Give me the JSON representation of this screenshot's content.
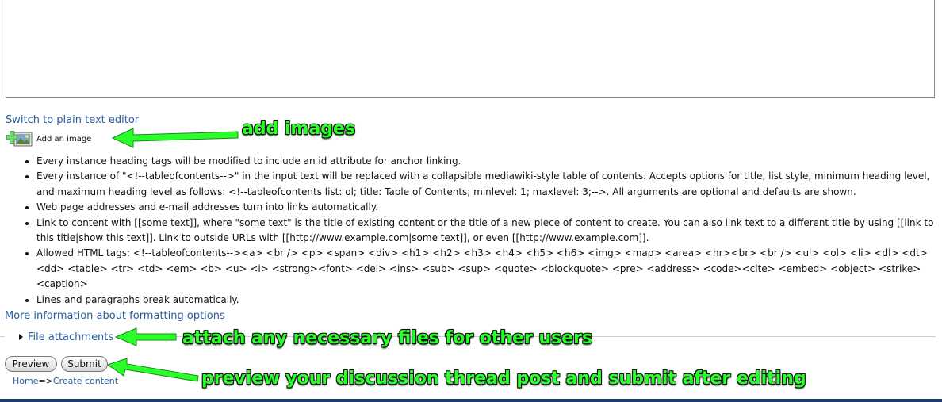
{
  "editor": {
    "switch_link": "Switch to plain text editor",
    "add_image_label": "Add an image"
  },
  "tips": [
    "Every instance heading tags will be modified to include an id attribute for anchor linking.",
    "Every instance of \"<!--tableofcontents-->\" in the input text will be replaced with a collapsible mediawiki-style table of contents. Accepts options for title, list style, minimum heading level, and maximum heading level as follows: <!--tableofcontents list: ol; title: Table of Contents; minlevel: 1; maxlevel: 3;-->. All arguments are optional and defaults are shown.",
    "Web page addresses and e-mail addresses turn into links automatically.",
    "Link to content with [[some text]], where \"some text\" is the title of existing content or the title of a new piece of content to create. You can also link text to a different title by using [[link to this title|show this text]]. Link to outside URLs with [[http://www.example.com|some text]], or even [[http://www.example.com]].",
    "Allowed HTML tags: <!--tableofcontents--><a> <br /> <p> <span> <div> <h1> <h2> <h3> <h4> <h5> <h6> <img> <map> <area> <hr><br> <br /> <ul> <ol> <li> <dl> <dt> <dd> <table> <tr> <td> <em> <b> <u> <i> <strong><font> <del> <ins> <sub> <sup> <quote> <blockquote> <pre> <address> <code><cite> <embed> <object> <strike> <caption>",
    "Lines and paragraphs break automatically."
  ],
  "more_info_link": "More information about formatting options",
  "file_attachments": "File attachments",
  "buttons": {
    "preview": "Preview",
    "submit": "Submit"
  },
  "breadcrumb": {
    "home": "Home",
    "separator": "=>",
    "create": "Create content"
  },
  "annotations": {
    "add_images": "add images",
    "attach": "attach any necessary files for other users",
    "preview_submit": "preview your discussion thread post and submit after editing"
  },
  "colors": {
    "link": "#2a5d9f",
    "annotation": "#2bff2b",
    "bottom_bar": "#1f3d6b"
  }
}
